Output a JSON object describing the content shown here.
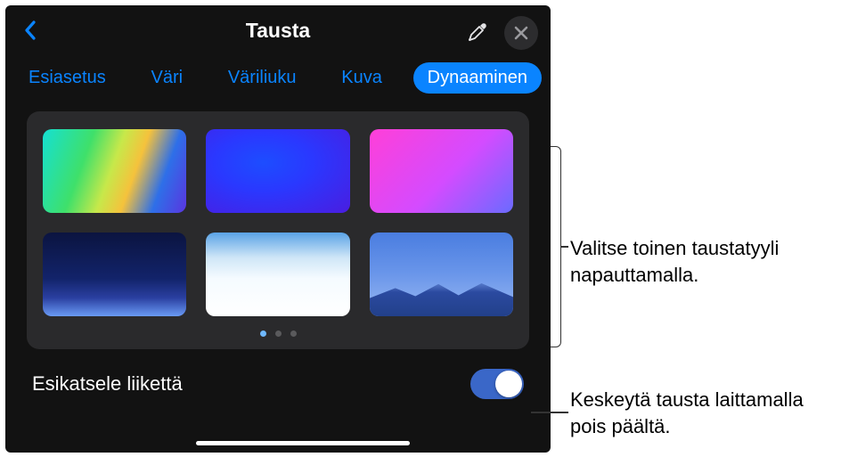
{
  "header": {
    "title": "Tausta"
  },
  "tabs": [
    {
      "label": "Esiasetus",
      "active": false
    },
    {
      "label": "Väri",
      "active": false
    },
    {
      "label": "Väriliuku",
      "active": false
    },
    {
      "label": "Kuva",
      "active": false
    },
    {
      "label": "Dynaaminen",
      "active": true
    }
  ],
  "swatches": [
    {
      "name": "rainbow-gradient"
    },
    {
      "name": "blue-radial"
    },
    {
      "name": "magenta-purple"
    },
    {
      "name": "deep-night"
    },
    {
      "name": "sky-white"
    },
    {
      "name": "blue-mountains"
    }
  ],
  "pager": {
    "count": 3,
    "active": 0
  },
  "toggle": {
    "label": "Esikatsele liikettä",
    "on": true
  },
  "callouts": {
    "chooseStyle": "Valitse toinen taustatyyli napauttamalla.",
    "pauseMotion": "Keskeytä tausta laittamalla pois päältä."
  },
  "icons": {
    "back": "chevron-left",
    "eyedropper": "eyedropper",
    "close": "xmark"
  }
}
